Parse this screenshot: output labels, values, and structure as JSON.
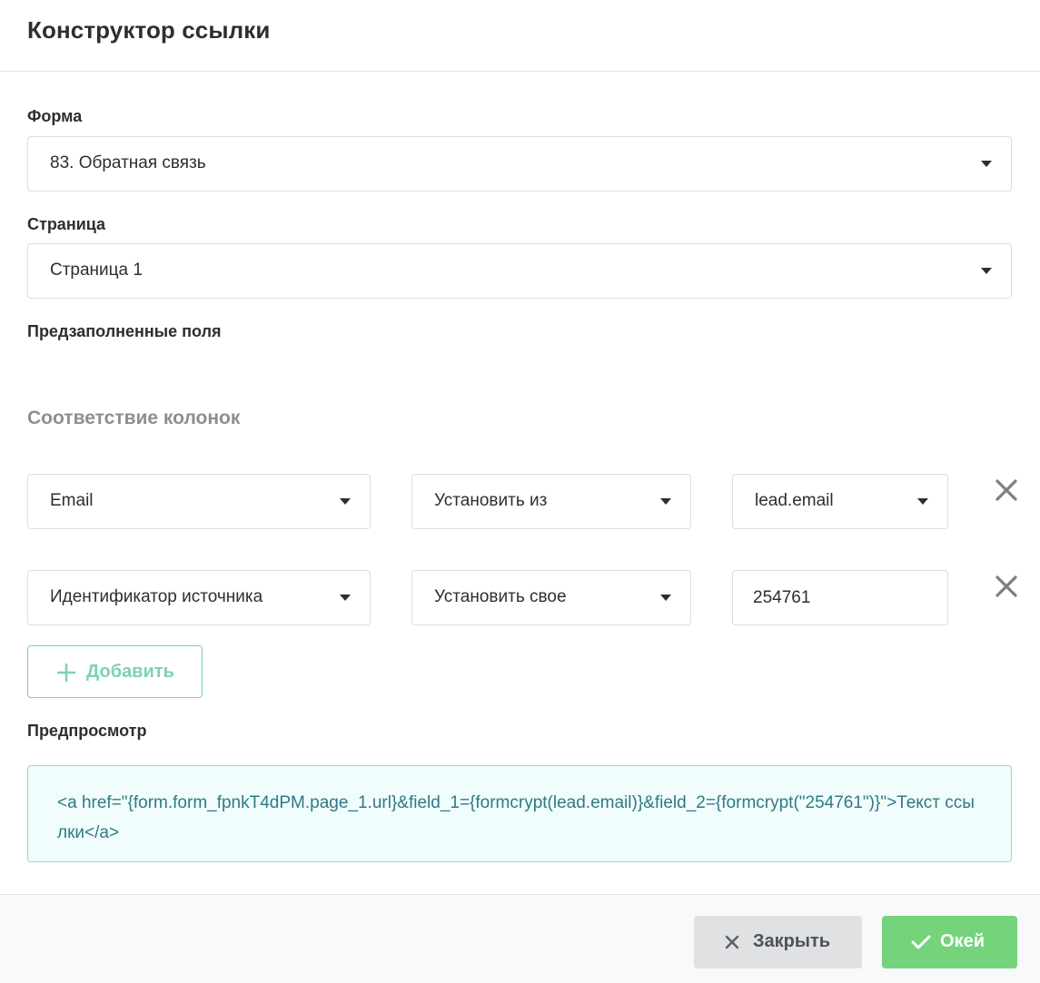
{
  "modal": {
    "title": "Конструктор ссылки"
  },
  "form": {
    "label": "Форма",
    "selected": "83. Обратная связь"
  },
  "page": {
    "label": "Страница",
    "selected": "Страница 1"
  },
  "prefilled": {
    "label": "Предзаполненные поля"
  },
  "mapping": {
    "heading": "Соответствие колонок",
    "rows": [
      {
        "field": "Email",
        "mode": "Установить из",
        "source": "lead.email"
      },
      {
        "field": "Идентификатор источника",
        "mode": "Установить свое",
        "value": "254761"
      }
    ],
    "add_label": "Добавить"
  },
  "preview": {
    "label": "Предпросмотр",
    "code": "<a href=\"{form.form_fpnkT4dPM.page_1.url}&field_1={formcrypt(lead.email)}&field_2={formcrypt(\"254761\")}\">Текст ссылки</a>"
  },
  "footer": {
    "close_label": "Закрыть",
    "ok_label": "Окей"
  },
  "colors": {
    "accent_green": "#74d37b",
    "add_button_green": "#7dd3ad",
    "preview_text": "#2d7a86",
    "preview_bg": "#f1fcfc"
  },
  "icons": {
    "caret": "chevron-down-icon",
    "remove": "close-icon",
    "add": "plus-icon",
    "close": "close-icon",
    "ok": "check-icon"
  }
}
